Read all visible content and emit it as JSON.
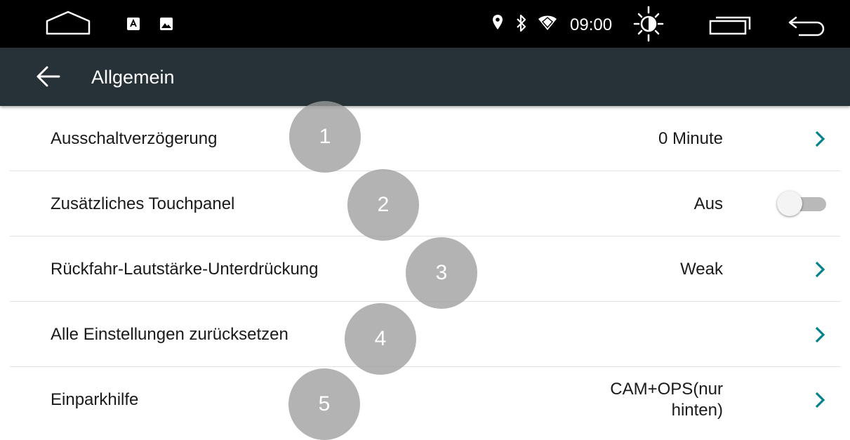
{
  "status_bar": {
    "time": "09:00",
    "icons": [
      "home-outline-icon",
      "keyboard-a-icon",
      "image-icon",
      "location-pin-icon",
      "bluetooth-icon",
      "wifi-icon",
      "brightness-icon",
      "recent-apps-icon",
      "back-arrow-icon"
    ]
  },
  "app_bar": {
    "title": "Allgemein",
    "back_icon": "arrow-left-icon"
  },
  "settings": [
    {
      "label": "Ausschaltverzögerung",
      "value": "0 Minute",
      "control": "chevron"
    },
    {
      "label": "Zusätzliches Touchpanel",
      "value": "Aus",
      "control": "toggle",
      "toggle_on": false
    },
    {
      "label": "Rückfahr-Lautstärke-Unterdrückung",
      "value": "Weak",
      "control": "chevron"
    },
    {
      "label": "Alle Einstellungen zurücksetzen",
      "value": "",
      "control": "chevron"
    },
    {
      "label": "Einparkhilfe",
      "value": "CAM+OPS(nur hinten)",
      "control": "chevron"
    }
  ],
  "markers": [
    "1",
    "2",
    "3",
    "4",
    "5"
  ],
  "colors": {
    "status_bar_bg": "#000000",
    "app_bar_bg": "#263238",
    "accent": "#00838F",
    "marker": "#9E9E9E"
  }
}
